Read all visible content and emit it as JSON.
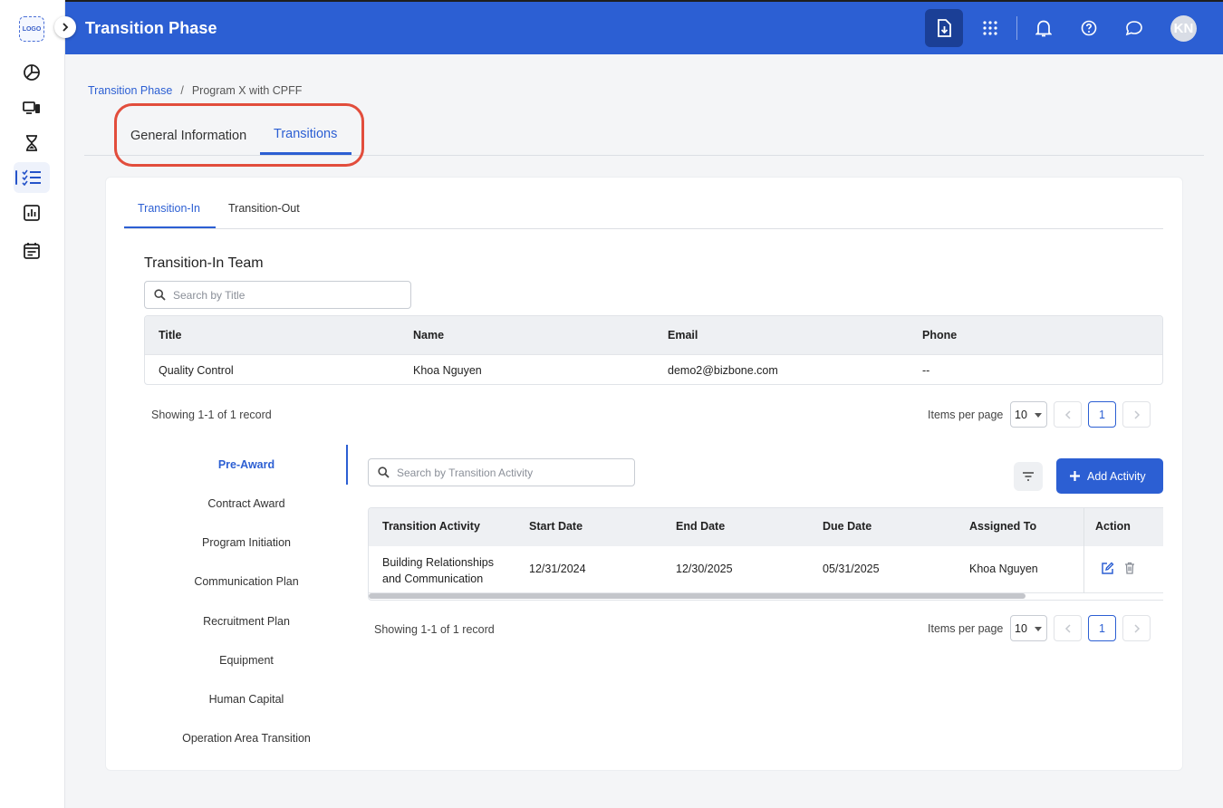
{
  "rail": {
    "logo": "LOGO",
    "items": [
      {
        "icon": "pie-chart-icon"
      },
      {
        "icon": "devices-icon"
      },
      {
        "icon": "hourglass-icon"
      },
      {
        "icon": "checklist-icon",
        "active": true
      },
      {
        "icon": "bar-chart-icon"
      },
      {
        "icon": "calendar-icon"
      }
    ]
  },
  "header": {
    "title": "Transition Phase",
    "avatar_initials": "KN",
    "accent": "#2c5fd3"
  },
  "breadcrumb": {
    "root": "Transition Phase",
    "separator": "/",
    "current": "Program X with CPFF"
  },
  "top_tabs": {
    "general": "General Information",
    "transitions": "Transitions",
    "active": "Transitions"
  },
  "sub_tabs": {
    "transition_in": "Transition-In",
    "transition_out": "Transition-Out",
    "active": "Transition-In"
  },
  "team": {
    "title": "Transition-In Team",
    "search_placeholder": "Search by Title",
    "columns": [
      "Title",
      "Name",
      "Email",
      "Phone"
    ],
    "rows": [
      [
        "Quality Control",
        "Khoa Nguyen",
        "demo2@bizbone.com",
        "--"
      ]
    ],
    "showing": "Showing 1-1 of 1 record",
    "items_per_page_label": "Items per page",
    "items_per_page": "10",
    "page": "1"
  },
  "steps": {
    "items": [
      "Pre-Award",
      "Contract Award",
      "Program Initiation",
      "Communication Plan",
      "Recruitment Plan",
      "Equipment",
      "Human Capital",
      "Operation Area Transition"
    ],
    "active": "Pre-Award"
  },
  "activity": {
    "search_placeholder": "Search by Transition Activity",
    "add_label": "Add Activity",
    "columns": [
      "Transition Activity",
      "Start Date",
      "End Date",
      "Due Date",
      "Assigned To",
      "Action"
    ],
    "rows": [
      {
        "activity_line1": "Building Relationships",
        "activity_line2": "and Communication",
        "start": "12/31/2024",
        "end": "12/30/2025",
        "due": "05/31/2025",
        "assigned": "Khoa Nguyen"
      }
    ],
    "showing": "Showing 1-1 of 1 record",
    "items_per_page_label": "Items per page",
    "items_per_page": "10",
    "page": "1"
  }
}
